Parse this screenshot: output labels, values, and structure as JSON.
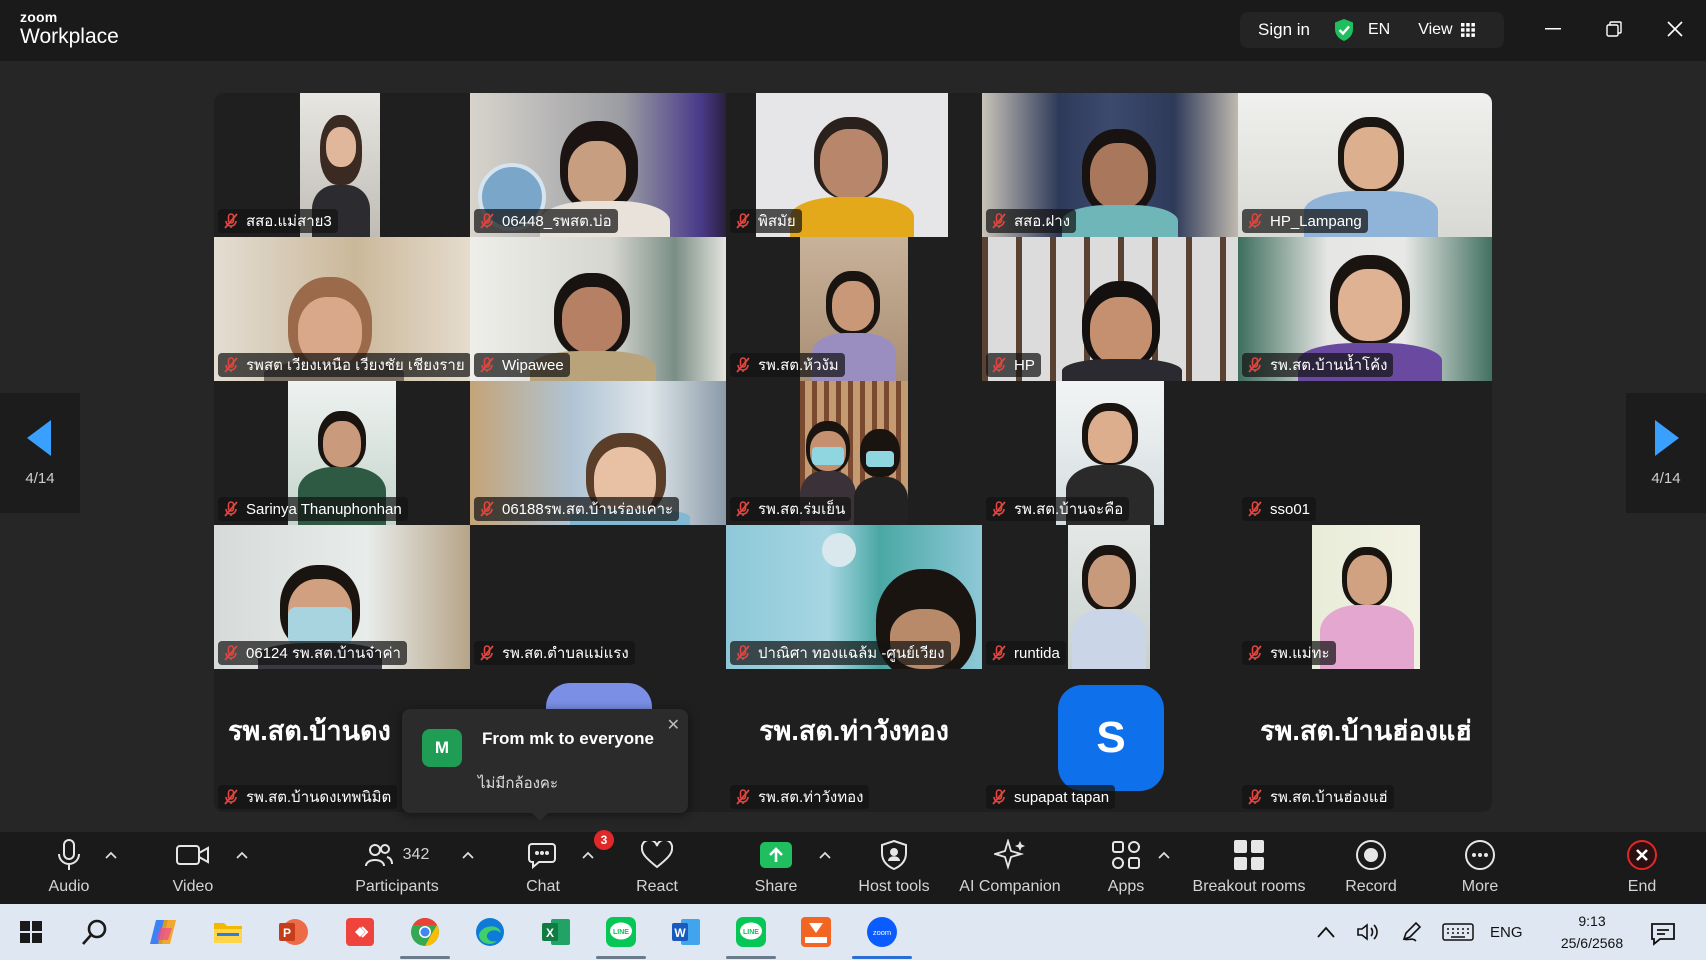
{
  "app": {
    "brand_small": "zoom",
    "brand_large": "Workplace"
  },
  "titlebar": {
    "sign_in": "Sign in",
    "lang": "EN",
    "view": "View"
  },
  "pager": {
    "left": "4/14",
    "right": "4/14"
  },
  "tiles": [
    {
      "name": "สสอ.แม่สาย3"
    },
    {
      "name": "06448_รพสต.บ่อ"
    },
    {
      "name": "พิสมัย"
    },
    {
      "name": "สสอ.ฝาง"
    },
    {
      "name": "HP_Lampang"
    },
    {
      "name": "รพสต เวียงเหนือ เวียงชัย เชียงราย"
    },
    {
      "name": "Wipawee"
    },
    {
      "name": "รพ.สต.ห้วงัม"
    },
    {
      "name": "HP"
    },
    {
      "name": "รพ.สต.บ้านน้ำโค้ง"
    },
    {
      "name": "Sarinya Thanuphonhan"
    },
    {
      "name": "06188รพ.สต.บ้านร่องเคาะ"
    },
    {
      "name": "รพ.สต.ร่มเย็น"
    },
    {
      "name": "รพ.สต.บ้านจะคือ"
    },
    {
      "name": "sso01"
    },
    {
      "name": "06124 รพ.สต.บ้านจ๋าค่า"
    },
    {
      "name": "รพ.สต.ตำบลแม่แรง"
    },
    {
      "name": "ปาณิศา ทองแฉล้ม -ศูนย์เวียง"
    },
    {
      "name": "runtida"
    },
    {
      "name": "รพ.แม่ทะ"
    },
    {
      "name": "รพ.สต.บ้านดงเทพนิมิต",
      "big": "รพ.สต.บ้านดง"
    },
    {
      "name": "รพ.สต.ท่าวังทอง",
      "big": "รพ.สต.ท่าวังทอง"
    },
    {
      "name": "supapat tapan",
      "initial": "S"
    },
    {
      "name": "รพ.สต.บ้านฮ่องแฮ่",
      "big": "รพ.สต.บ้านฮ่องแฮ่"
    }
  ],
  "chat_popup": {
    "avatar": "M",
    "from": "From mk to everyone",
    "message": "ไม่มีกล้องคะ"
  },
  "toolbar": {
    "audio": "Audio",
    "video": "Video",
    "participants": "Participants",
    "participants_count": "342",
    "chat": "Chat",
    "chat_badge": "3",
    "react": "React",
    "share": "Share",
    "host_tools": "Host tools",
    "ai_companion": "AI Companion",
    "apps": "Apps",
    "breakout": "Breakout rooms",
    "record": "Record",
    "more": "More",
    "end": "End"
  },
  "taskbar": {
    "lang": "ENG",
    "time": "9:13",
    "date": "25/6/2568"
  },
  "colors": {
    "accent": "#0e71eb",
    "end": "#e02828",
    "share": "#1fbf5f",
    "muted": "#e0453e"
  }
}
